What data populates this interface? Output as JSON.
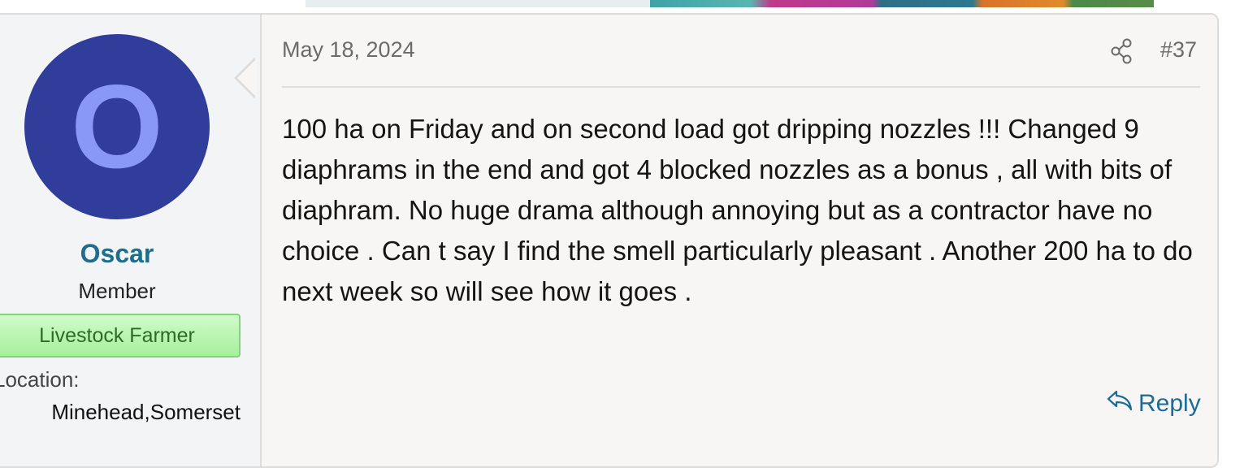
{
  "colors": {
    "avatar_bg": "#303d9b",
    "avatar_letter": "#8998f4",
    "username": "#1f6d8c",
    "banner_bg": "#b8f5b0",
    "banner_text": "#2e6b2b",
    "link": "#1e6c95"
  },
  "user": {
    "avatar_letter": "O",
    "name": "Oscar",
    "title": "Member",
    "banner": "Livestock Farmer",
    "location_label": "Location:",
    "location_value": "Minehead,Somerset"
  },
  "post": {
    "date": "May 18, 2024",
    "share_icon": "share-icon",
    "number": "#37",
    "message": "100 ha on Friday and on second load got dripping nozzles !!! Changed 9 diaphrams in the end and got 4 blocked nozzles as a bonus , all with bits of diaphram. No huge drama although annoying but as a contractor have no choice . Can t say I find the smell particularly pleasant . Another 200 ha to do next week so will see how it goes .",
    "reply_label": "Reply",
    "reply_icon": "reply-icon"
  }
}
